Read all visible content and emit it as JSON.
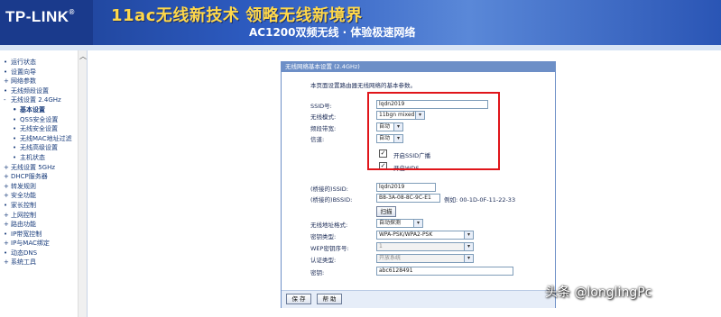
{
  "banner": {
    "logo": "TP-LINK",
    "slogan_line1": "11ac无线新技术 领略无线新境界",
    "slogan_line2": "AC1200双频无线 · 体验极速网络"
  },
  "sidebar": {
    "items": [
      {
        "label": "运行状态",
        "bullet": "•"
      },
      {
        "label": "设置向导",
        "bullet": "•"
      },
      {
        "label": "网络参数",
        "bullet": "+"
      },
      {
        "label": "无线频段设置",
        "bullet": "•"
      },
      {
        "label": "无线设置 2.4GHz",
        "bullet": "-"
      },
      {
        "label": "基本设置",
        "bullet": "•"
      },
      {
        "label": "QSS安全设置",
        "bullet": "•"
      },
      {
        "label": "无线安全设置",
        "bullet": "•"
      },
      {
        "label": "无线MAC地址过滤",
        "bullet": "•"
      },
      {
        "label": "无线高级设置",
        "bullet": "•"
      },
      {
        "label": "主机状态",
        "bullet": "•"
      },
      {
        "label": "无线设置 5GHz",
        "bullet": "+"
      },
      {
        "label": "DHCP服务器",
        "bullet": "+"
      },
      {
        "label": "转发规则",
        "bullet": "+"
      },
      {
        "label": "安全功能",
        "bullet": "+"
      },
      {
        "label": "家长控制",
        "bullet": "•"
      },
      {
        "label": "上网控制",
        "bullet": "+"
      },
      {
        "label": "路由功能",
        "bullet": "+"
      },
      {
        "label": "IP带宽控制",
        "bullet": "•"
      },
      {
        "label": "IP与MAC绑定",
        "bullet": "+"
      },
      {
        "label": "动态DNS",
        "bullet": "•"
      },
      {
        "label": "系统工具",
        "bullet": "+"
      }
    ]
  },
  "form": {
    "title": "无线网络基本设置 (2.4GHz)",
    "description": "本页面设置路由器无线网络的基本参数。",
    "ssid_label": "SSID号:",
    "ssid_value": "lqdn2019",
    "mode_label": "无线模式:",
    "mode_value": "11bgn mixed",
    "bandwidth_label": "频段带宽:",
    "bandwidth_value": "自动",
    "channel_label": "信道:",
    "channel_value": "自动",
    "enable_ssid_broadcast": "开启SSID广播",
    "enable_wds": "开启WDS",
    "bridge_ssid_label": "(桥接的)SSID:",
    "bridge_ssid_value": "lqdn2019",
    "bridge_bssid_label": "(桥接的)BSSID:",
    "bridge_bssid_value": "B8-3A-08-8C-9C-E1",
    "bssid_example": "例如: 00-1D-0F-11-22-33",
    "scan_button": "扫描",
    "addr_format_label": "无线地址格式:",
    "addr_format_value": "自动探测",
    "key_type_label": "密钥类型:",
    "key_type_value": "WPA-PSK/WPA2-PSK",
    "wep_index_label": "WEP密钥序号:",
    "wep_index_value": "1",
    "auth_type_label": "认证类型:",
    "auth_type_value": "开放系统",
    "key_label": "密钥:",
    "key_value": "abc6128491",
    "save_button": "保 存",
    "help_button": "帮 助"
  },
  "watermark": "头条 @longlingPc",
  "colors": {
    "banner_dark": "#1b3d8f",
    "slogan_yellow": "#ffd84a",
    "frame_blue": "#6d8fc7",
    "highlight_red": "#e0151a"
  }
}
